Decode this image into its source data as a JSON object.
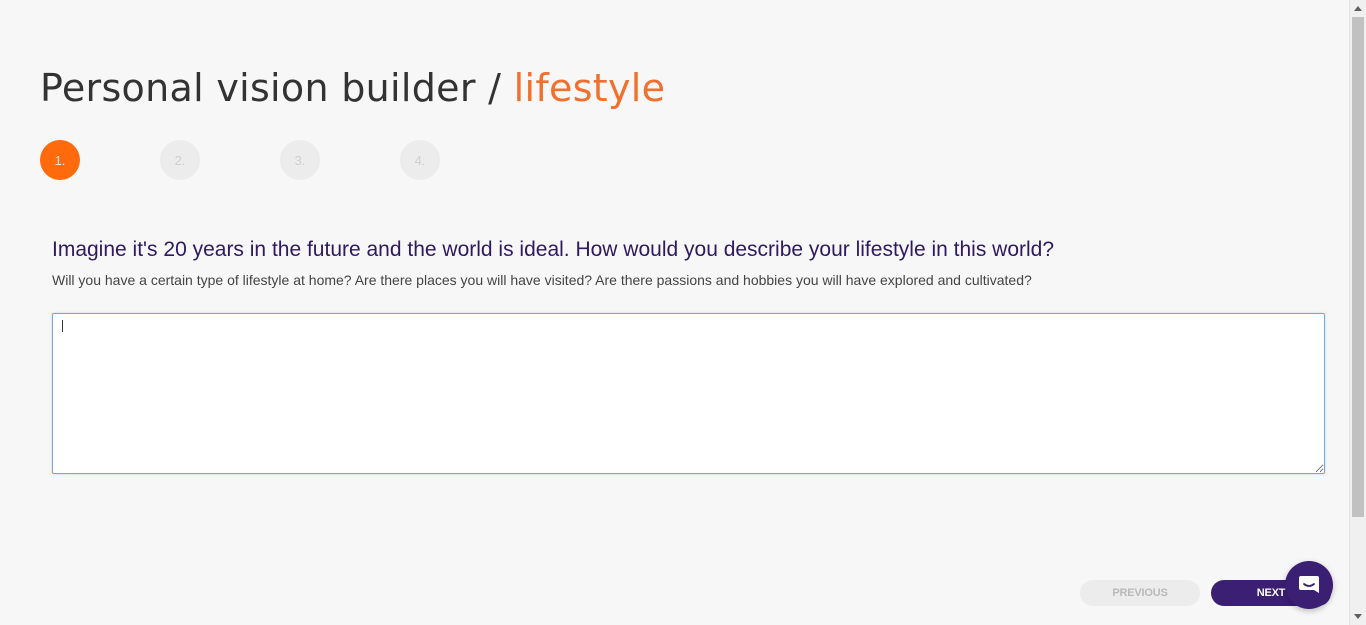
{
  "header": {
    "title_main": "Personal vision builder / ",
    "title_accent": "lifestyle",
    "accent_color": "#f0702e"
  },
  "steps": [
    {
      "label": "1.",
      "active": true
    },
    {
      "label": "2.",
      "active": false
    },
    {
      "label": "3.",
      "active": false
    },
    {
      "label": "4.",
      "active": false
    }
  ],
  "question": {
    "heading": "Imagine it's 20 years in the future and the world is ideal. How would you describe your lifestyle in this world?",
    "subtext": "Will you have a certain type of lifestyle at home? Are there places you will have visited? Are there passions and hobbies you will have explored and cultivated?"
  },
  "answer": {
    "value": ""
  },
  "navigation": {
    "previous_label": "PREVIOUS",
    "next_label": "NEXT"
  },
  "chat": {
    "icon": "chat-bubble-icon"
  },
  "colors": {
    "primary": "#3b1f73",
    "step_active": "#ff6a0d",
    "heading": "#2e1a5e"
  }
}
